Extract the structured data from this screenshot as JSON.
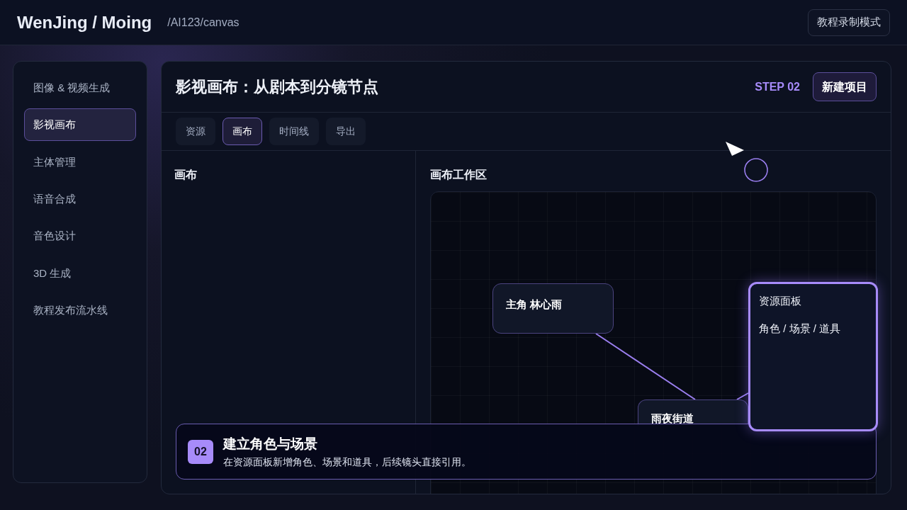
{
  "header": {
    "brand": "WenJing / Moing",
    "path": "/AI123/canvas",
    "mode_button": "教程录制模式"
  },
  "sidebar": {
    "items": [
      {
        "label": "图像 & 视频生成",
        "selected": false
      },
      {
        "label": "影视画布",
        "selected": true
      },
      {
        "label": "主体管理",
        "selected": false
      },
      {
        "label": "语音合成",
        "selected": false
      },
      {
        "label": "音色设计",
        "selected": false
      },
      {
        "label": "3D 生成",
        "selected": false
      },
      {
        "label": "教程发布流水线",
        "selected": false
      }
    ]
  },
  "page": {
    "title": "影视画布：从剧本到分镜节点",
    "step": "STEP 02",
    "new_project_button": "新建项目"
  },
  "tabs": [
    {
      "label": "资源",
      "selected": false
    },
    {
      "label": "画布",
      "selected": true
    },
    {
      "label": "时间线",
      "selected": false
    },
    {
      "label": "导出",
      "selected": false
    }
  ],
  "left_panel": {
    "heading": "画布"
  },
  "workspace": {
    "heading": "画布工作区",
    "nodes": [
      {
        "title": "主角 林心雨",
        "highlighted": false
      },
      {
        "title": "雨夜街道",
        "highlighted": false
      },
      {
        "title": "资源面板",
        "subtitle": "角色 / 场景 / 道具",
        "highlighted": true
      }
    ]
  },
  "tutorial_callout": {
    "step": "02",
    "title": "建立角色与场景",
    "text": "在资源面板新增角色、场景和道具，后续镜头直接引用。"
  }
}
